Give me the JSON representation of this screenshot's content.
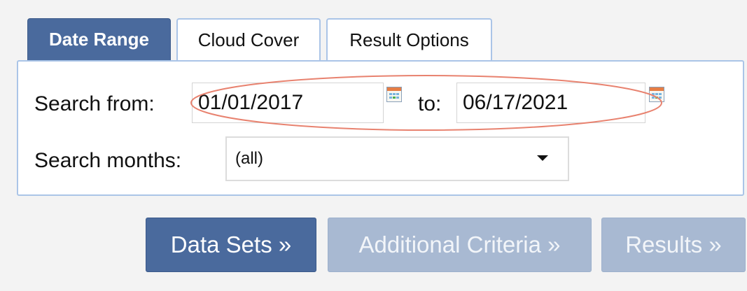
{
  "tabs": [
    {
      "label": "Date Range",
      "active": true
    },
    {
      "label": "Cloud Cover",
      "active": false
    },
    {
      "label": "Result Options",
      "active": false
    }
  ],
  "date_range": {
    "from_label": "Search from:",
    "from_value": "01/01/2017",
    "to_label": "to:",
    "to_value": "06/17/2021",
    "months_label": "Search months:",
    "months_value": "(all)"
  },
  "buttons": {
    "data_sets": "Data Sets »",
    "additional_criteria": "Additional Criteria »",
    "results": "Results »"
  },
  "icons": {
    "calendar": "calendar-icon",
    "dropdown": "chevron-down-icon"
  },
  "colors": {
    "accent": "#4a6a9d",
    "tab_border": "#aac4e7",
    "disabled_button": "#a8b9d2",
    "highlight_oval": "#e8826f"
  }
}
